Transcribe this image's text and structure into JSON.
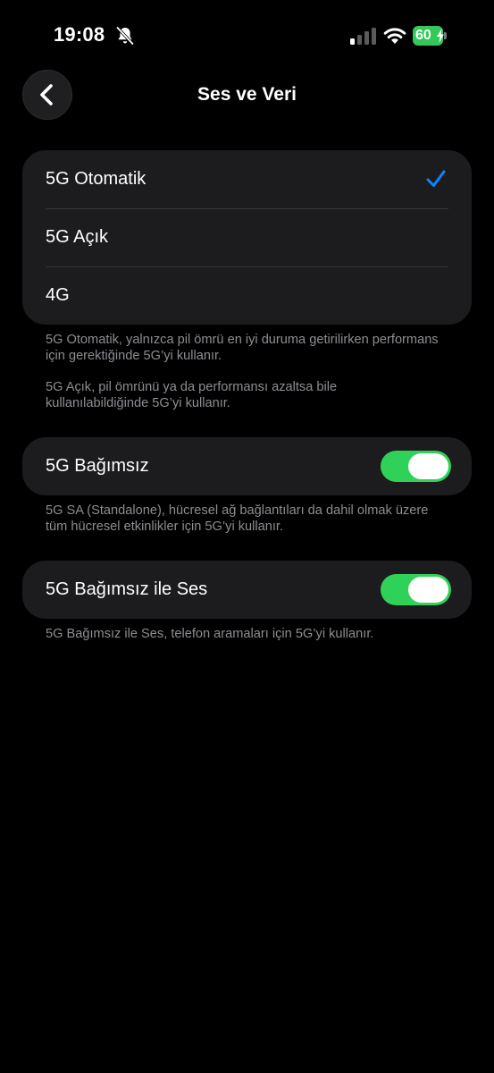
{
  "status_bar": {
    "time": "19:08",
    "battery": "60",
    "icons": [
      "bell-slash-icon",
      "cellular-signal-icon",
      "wifi-icon",
      "battery-charging-icon"
    ]
  },
  "nav": {
    "title": "Ses ve Veri",
    "back_icon": "chevron-left-icon"
  },
  "voice_data": {
    "options": [
      {
        "label": "5G Otomatik",
        "selected": true
      },
      {
        "label": "5G Açık",
        "selected": false
      },
      {
        "label": "4G",
        "selected": false
      }
    ],
    "footnote_1": "5G Otomatik, yalnızca pil ömrü en iyi duruma getirilirken performans için gerektiğinde 5G’yi kullanır.",
    "footnote_2": "5G Açık, pil ömrünü ya da performansı azaltsa bile kullanılabildiğinde 5G’yi kullanır."
  },
  "standalone": {
    "label": "5G Bağımsız",
    "enabled": true,
    "footnote": "5G SA (Standalone), hücresel ağ bağlantıları da dahil olmak üzere tüm hücresel etkinlikler için 5G’yi kullanır."
  },
  "standalone_voice": {
    "label": "5G Bağımsız ile Ses",
    "enabled": true,
    "footnote": "5G Bağımsız ile Ses, telefon aramaları için 5G’yi kullanır."
  },
  "colors": {
    "accent": "#0a84ff",
    "toggle_on": "#30d158",
    "battery": "#34c759",
    "group_bg": "#1c1c1e"
  }
}
